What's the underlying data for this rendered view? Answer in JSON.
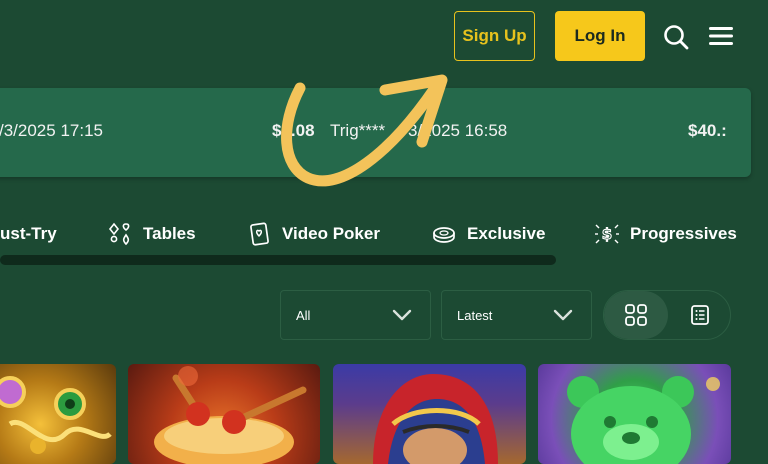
{
  "header": {
    "signup_label": "Sign Up",
    "login_label": "Log In",
    "search_icon": "search-icon",
    "menu_icon": "hamburger-menu-icon"
  },
  "ticker": {
    "items": [
      {
        "date": "/3/2025 17:15"
      },
      {
        "amount": "$0.08",
        "user": "Trig****",
        "date": "3/2025 16:58"
      },
      {
        "amount": "$40.:"
      }
    ]
  },
  "categories": [
    {
      "label": "ust-Try",
      "icon": "must-try-icon"
    },
    {
      "label": "Tables",
      "icon": "cards-icon"
    },
    {
      "label": "Video Poker",
      "icon": "video-poker-icon"
    },
    {
      "label": "Exclusive",
      "icon": "chip-icon"
    },
    {
      "label": "Progressives",
      "icon": "dollar-sparkle-icon"
    }
  ],
  "filters": {
    "provider_selected": "All",
    "sort_selected": "Latest"
  },
  "view": {
    "grid_icon": "grid-view-icon",
    "list_icon": "list-view-icon",
    "active": "grid"
  },
  "games": [
    {
      "thumb": "golden-mask"
    },
    {
      "thumb": "drum"
    },
    {
      "thumb": "fortune-teller"
    },
    {
      "thumb": "gummy-bear"
    }
  ],
  "colors": {
    "background": "#1c4a33",
    "ticker_bg": "#25694b",
    "accent": "#f6c81b",
    "arrow": "#f3c35a"
  }
}
